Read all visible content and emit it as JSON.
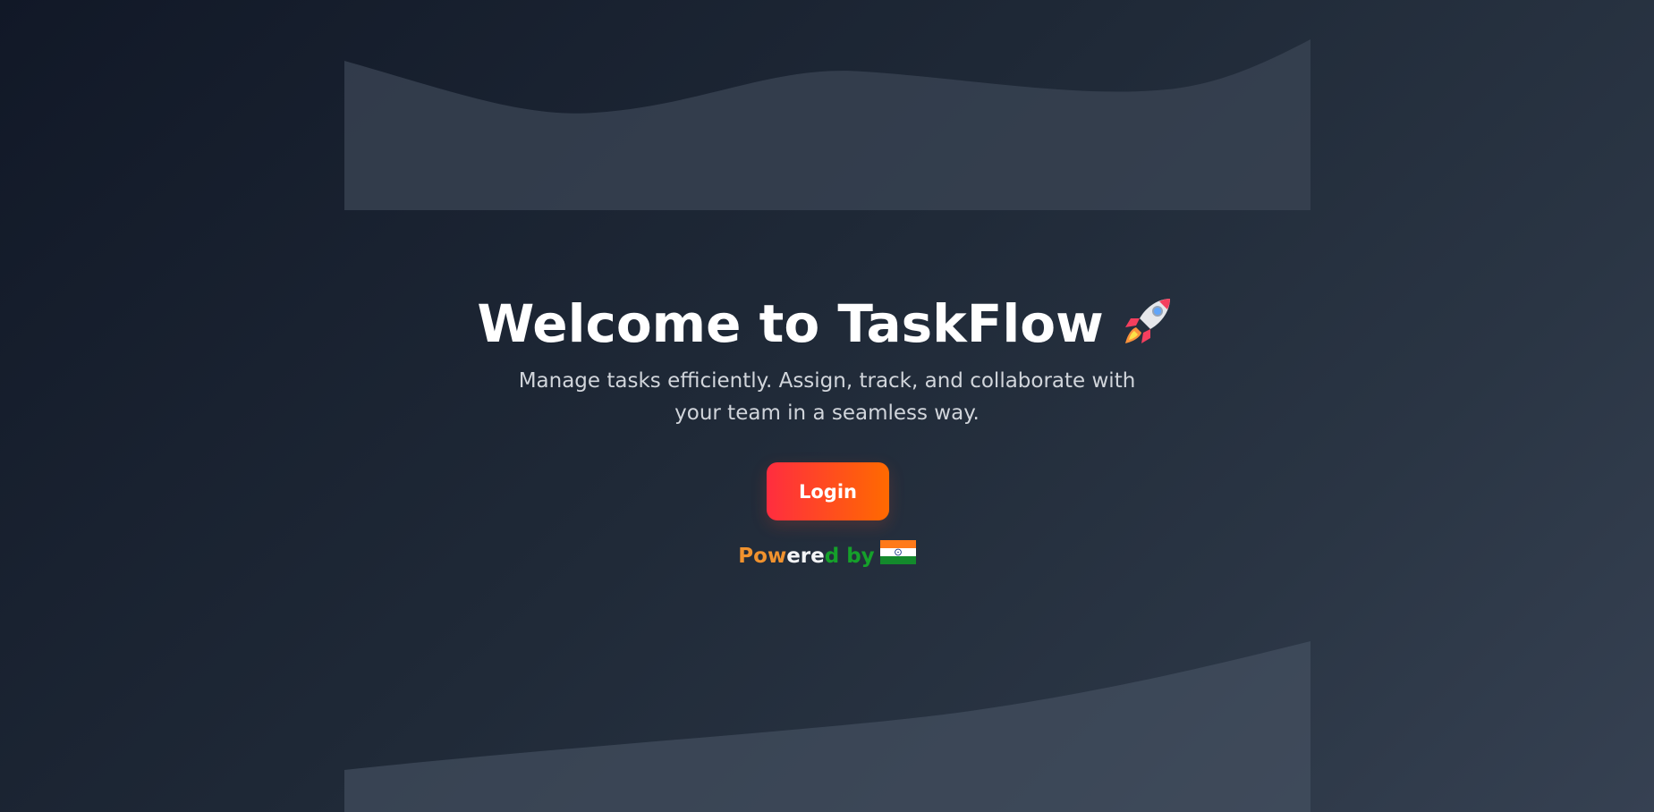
{
  "hero": {
    "title": "Welcome to TaskFlow",
    "subtitle": "Manage tasks efficiently. Assign, track, and collaborate with your team in a seamless way.",
    "login_label": "Login",
    "powered_by": {
      "part1": "Pow",
      "part2": "ere",
      "part3": "d by"
    }
  },
  "icons": {
    "title_icon": "rocket-icon",
    "flag_icon": "india-flag-icon"
  },
  "colors": {
    "background_dark": "#111827",
    "background_light": "#364152",
    "wave": "#3a4453",
    "button_start": "#ff2d3f",
    "button_end": "#ff6a00",
    "saffron": "#f0922e",
    "white": "#f3f4f6",
    "green": "#15a02a"
  }
}
